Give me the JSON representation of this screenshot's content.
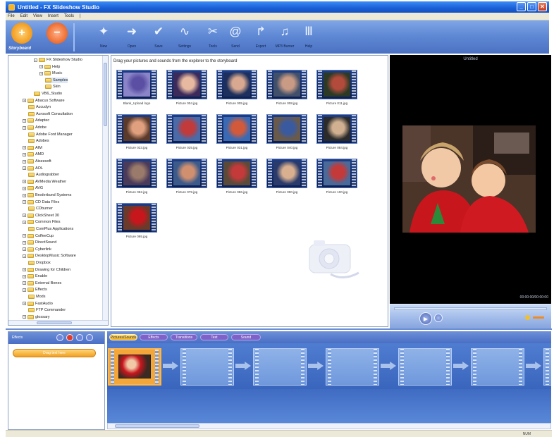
{
  "window": {
    "title": "Untitled - FX Slideshow Studio",
    "minimize": "_",
    "maximize": "□",
    "close": "✕"
  },
  "menu": [
    "File",
    "Edit",
    "View",
    "Insert",
    "Tools",
    "|"
  ],
  "toolbar": {
    "add_icon": "+",
    "remove_icon": "−",
    "storyboard_label": "Storyboard",
    "tools": [
      {
        "label": "New",
        "icon": "magic-wand-icon",
        "glyph": "✦"
      },
      {
        "label": "Open",
        "icon": "open-icon",
        "glyph": "➜"
      },
      {
        "label": "Save",
        "icon": "save-icon",
        "glyph": "✔"
      },
      {
        "label": "Settings",
        "icon": "settings-icon",
        "glyph": "∿"
      },
      {
        "label": "Tools",
        "icon": "tools-icon",
        "glyph": "✂"
      },
      {
        "label": "Send",
        "icon": "send-icon",
        "glyph": "@"
      },
      {
        "label": "Export",
        "icon": "export-icon",
        "glyph": "↱"
      },
      {
        "label": "MP3 Burner",
        "icon": "music-icon",
        "glyph": "♫"
      },
      {
        "label": "Help",
        "icon": "help-icon",
        "glyph": "Ⅲ"
      }
    ]
  },
  "tree": {
    "items": [
      {
        "label": "FX Slideshow Studio",
        "indent": 5,
        "exp": "−"
      },
      {
        "label": "Help",
        "indent": 6,
        "exp": "+"
      },
      {
        "label": "Music",
        "indent": 6,
        "exp": "+"
      },
      {
        "label": "Samples",
        "indent": 7,
        "exp": "",
        "selected": true
      },
      {
        "label": "Skin",
        "indent": 7,
        "exp": ""
      },
      {
        "label": "VB6_Studio",
        "indent": 5,
        "exp": ""
      },
      {
        "label": "Abacus Software",
        "indent": 3,
        "exp": "+"
      },
      {
        "label": "Accudyn",
        "indent": 4,
        "exp": ""
      },
      {
        "label": "Acrosoft Consultation",
        "indent": 4,
        "exp": ""
      },
      {
        "label": "Adaptec",
        "indent": 3,
        "exp": "+"
      },
      {
        "label": "Adobe",
        "indent": 3,
        "exp": "+"
      },
      {
        "label": "Adobe Font Manager",
        "indent": 4,
        "exp": ""
      },
      {
        "label": "Adobes",
        "indent": 4,
        "exp": ""
      },
      {
        "label": "AIM",
        "indent": 3,
        "exp": "+"
      },
      {
        "label": "AMD",
        "indent": 3,
        "exp": "+"
      },
      {
        "label": "Aiseesoft",
        "indent": 3,
        "exp": "+"
      },
      {
        "label": "AOL",
        "indent": 3,
        "exp": "+"
      },
      {
        "label": "Audiograbber",
        "indent": 4,
        "exp": ""
      },
      {
        "label": "AVMedia Weather",
        "indent": 3,
        "exp": "+"
      },
      {
        "label": "AVG",
        "indent": 3,
        "exp": "+"
      },
      {
        "label": "Broderbund Systems",
        "indent": 3,
        "exp": "+"
      },
      {
        "label": "CD Data Files",
        "indent": 3,
        "exp": "+"
      },
      {
        "label": "CDburner",
        "indent": 4,
        "exp": ""
      },
      {
        "label": "ClickSheet 30",
        "indent": 3,
        "exp": "+"
      },
      {
        "label": "Common Files",
        "indent": 3,
        "exp": "+"
      },
      {
        "label": "ComPlus Applications",
        "indent": 4,
        "exp": ""
      },
      {
        "label": "CoffeeCup",
        "indent": 3,
        "exp": "+"
      },
      {
        "label": "DirectSound",
        "indent": 3,
        "exp": "+"
      },
      {
        "label": "Cyberlink",
        "indent": 3,
        "exp": "+"
      },
      {
        "label": "DesktopMusic Software",
        "indent": 3,
        "exp": "+"
      },
      {
        "label": "Dropbox",
        "indent": 4,
        "exp": ""
      },
      {
        "label": "Drawing for Children",
        "indent": 3,
        "exp": "+"
      },
      {
        "label": "Enable",
        "indent": 3,
        "exp": "+"
      },
      {
        "label": "External Bones",
        "indent": 3,
        "exp": "+"
      },
      {
        "label": "Effects",
        "indent": 3,
        "exp": "+"
      },
      {
        "label": "Mods",
        "indent": 4,
        "exp": ""
      },
      {
        "label": "FastAudio",
        "indent": 3,
        "exp": "+"
      },
      {
        "label": "FTP Commander",
        "indent": 4,
        "exp": ""
      },
      {
        "label": "glossary",
        "indent": 3,
        "exp": "+"
      }
    ]
  },
  "thumbs": {
    "hint": "Drag your pictures and sounds from the explorer to the storyboard",
    "tiles": [
      {
        "caption": "Blank_Upload logo",
        "kind": "logo"
      },
      {
        "caption": "Picture 004.jpg",
        "kind": "a"
      },
      {
        "caption": "Picture 005.jpg",
        "kind": "b"
      },
      {
        "caption": "Picture 008.jpg",
        "kind": "c"
      },
      {
        "caption": "Picture 011.jpg",
        "kind": "d"
      },
      {
        "caption": "Picture 023.jpg",
        "kind": "e"
      },
      {
        "caption": "Picture 025.jpg",
        "kind": "f"
      },
      {
        "caption": "Picture 031.jpg",
        "kind": "g"
      },
      {
        "caption": "Picture 040.jpg",
        "kind": "h"
      },
      {
        "caption": "Picture 084.jpg",
        "kind": "i"
      },
      {
        "caption": "Picture 052.jpg",
        "kind": "j"
      },
      {
        "caption": "Picture 079.jpg",
        "kind": "k"
      },
      {
        "caption": "Picture 086.jpg",
        "kind": "l"
      },
      {
        "caption": "Picture 090.jpg",
        "kind": "m"
      },
      {
        "caption": "Picture 100.jpg",
        "kind": "n"
      },
      {
        "caption": "Picture 095.jpg",
        "kind": "o"
      }
    ]
  },
  "preview": {
    "title": "Untitled",
    "time": "00:00:00/00:00:00",
    "play": "▶",
    "progress": 0
  },
  "bottom": {
    "left_header": "Effects",
    "left_pill": "Drag text here",
    "tabs": [
      {
        "label": "Pictures/Sounds",
        "active": true
      },
      {
        "label": "Effects",
        "active": false
      },
      {
        "label": "Transitions",
        "active": false
      },
      {
        "label": "Text",
        "active": false
      },
      {
        "label": "Sound",
        "active": false
      }
    ]
  },
  "status": {
    "text": "NUM"
  }
}
